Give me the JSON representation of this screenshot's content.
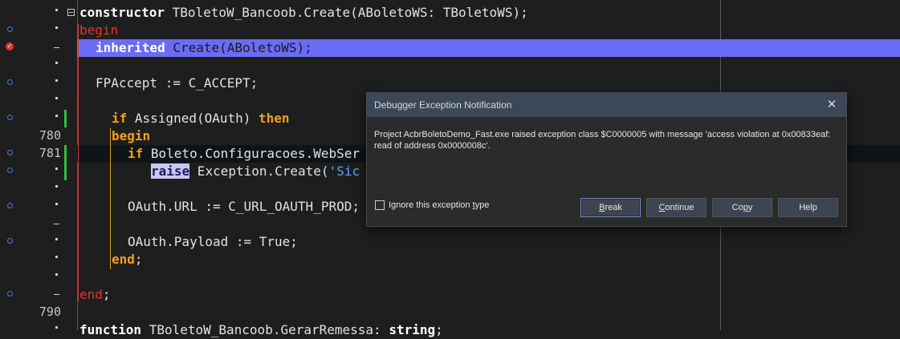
{
  "editor": {
    "lines": [
      {
        "num": "",
        "code": "constructor TBoletoW_Bancoob.Create(ABoletoWS: TBoletoWS);"
      },
      {
        "num": "",
        "code": "begin"
      },
      {
        "num": "",
        "code": "  inherited Create(ABoletoWS);"
      },
      {
        "num": "",
        "code": ""
      },
      {
        "num": "",
        "code": "  FPAccept := C_ACCEPT;"
      },
      {
        "num": "",
        "code": ""
      },
      {
        "num": "",
        "code": "    if Assigned(OAuth) then"
      },
      {
        "num": "780",
        "code": "    begin"
      },
      {
        "num": "781",
        "code": "      if Boleto.Configuracoes.WebSer"
      },
      {
        "num": "",
        "code": "         raise Exception.Create('Sic"
      },
      {
        "num": "",
        "code": ""
      },
      {
        "num": "",
        "code": "      OAuth.URL := C_URL_OAUTH_PROD;"
      },
      {
        "num": "",
        "code": ""
      },
      {
        "num": "",
        "code": "      OAuth.Payload := True;"
      },
      {
        "num": "",
        "code": "    end;"
      },
      {
        "num": "",
        "code": ""
      },
      {
        "num": "",
        "code": "end;"
      },
      {
        "num": "790",
        "code": ""
      },
      {
        "num": "",
        "code": "function TBoletoW_Bancoob.GerarRemessa: string;"
      }
    ],
    "tokens": {
      "l0_kw": "constructor",
      "l0_rest": " TBoletoW_Bancoob.Create(ABoletoWS: TBoletoWS);",
      "l1_kw": "begin",
      "l2_kw": "inherited",
      "l2_rest": " Create(ABoletoWS);",
      "l4_rest": "FPAccept := C_ACCEPT;",
      "l6_kw": "if",
      "l6_mid": " Assigned(OAuth) ",
      "l6_kw2": "then",
      "l7_kw": "begin",
      "l8_kw": "if",
      "l8_rest": " Boleto.Configuracoes.WebSer",
      "l9_kw": "raise",
      "l9_rest": " Exception.Create(",
      "l9_str": "'Sic",
      "l11_rest": "OAuth.URL := C_URL_OAUTH_PROD;",
      "l13_rest": "OAuth.Payload := True;",
      "l14_kw": "end",
      "l14_rest": ";",
      "l16_kw": "end",
      "l16_rest": ";",
      "l18_kw": "function",
      "l18_mid": " TBoletoW_Bancoob.GerarRemessa: ",
      "l18_kw2": "string",
      "l18_rest": ";"
    },
    "line_numbers": {
      "n780": "780",
      "n781": "781",
      "n790": "790"
    }
  },
  "dialog": {
    "title": "Debugger Exception Notification",
    "message": "Project AcbrBoletoDemo_Fast.exe raised exception class $C0000005 with message 'access violation at 0x00833eaf: read of address 0x0000008c'.",
    "checkbox_label_pre": "Ignore this exception ",
    "checkbox_label_u": "t",
    "checkbox_label_post": "ype",
    "buttons": {
      "break_u": "B",
      "break_rest": "reak",
      "continue_u": "C",
      "continue_rest": "ontinue",
      "copy_pre": "Co",
      "copy_u": "p",
      "copy_post": "y",
      "help": "Help"
    }
  },
  "colors": {
    "highlight": "#6b6cf5",
    "keyword_red": "#e8302a",
    "keyword_orange": "#f0a020",
    "string": "#4fa8ff"
  }
}
